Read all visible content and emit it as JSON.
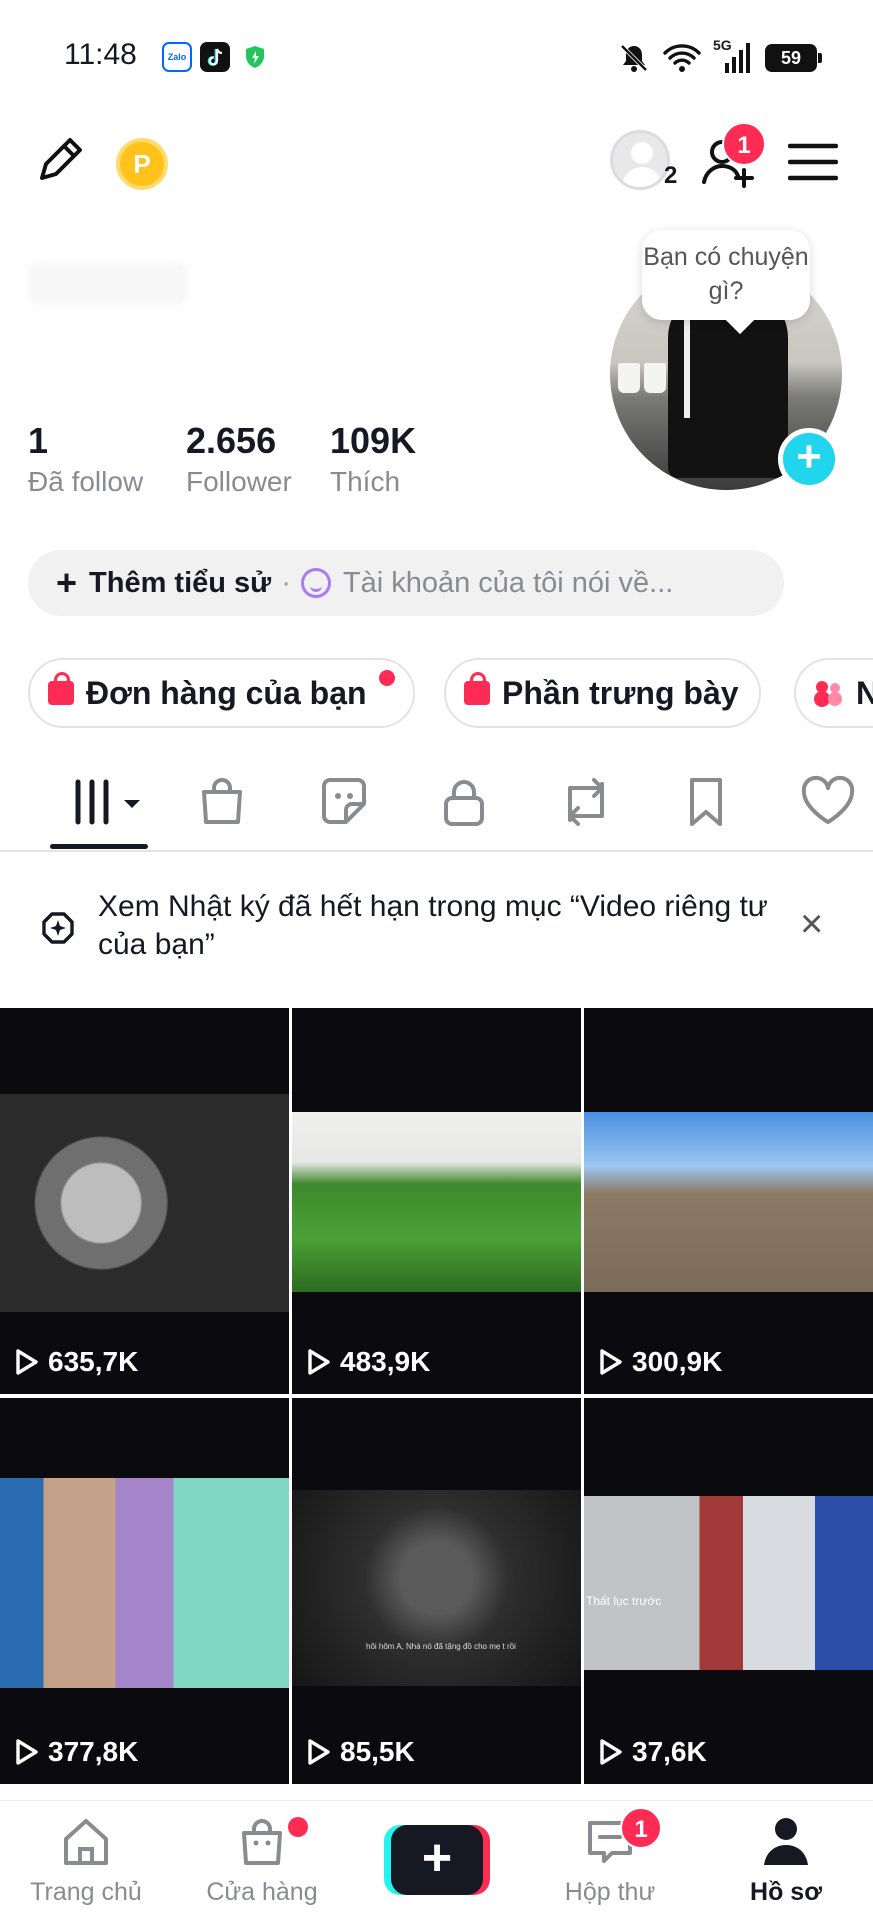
{
  "status_bar": {
    "time": "11:48",
    "zalo_label": "Zalo",
    "network": "5G",
    "battery": "59"
  },
  "header": {
    "coin_label": "P",
    "follower_requests_count": "2",
    "friend_badge": "1"
  },
  "profile": {
    "avatar_tooltip": "Bạn có chuyện gì?",
    "stats": [
      {
        "value": "1",
        "label": "Đã follow"
      },
      {
        "value": "2.656",
        "label": "Follower"
      },
      {
        "value": "109K",
        "label": "Thích"
      }
    ],
    "bio": {
      "add_label": "Thêm tiểu sử",
      "separator": "·",
      "hint": "Tài khoản của tôi nói về..."
    },
    "chips": [
      {
        "label": "Đơn hàng của bạn",
        "dot": true
      },
      {
        "label": "Phần trưng bày",
        "dot": false
      },
      {
        "label": "N",
        "dot": false
      }
    ]
  },
  "tabs": [
    {
      "icon": "grid-icon",
      "active": true
    },
    {
      "icon": "shop-bag-icon",
      "active": false
    },
    {
      "icon": "sticker-icon",
      "active": false
    },
    {
      "icon": "lock-icon",
      "active": false
    },
    {
      "icon": "repost-icon",
      "active": false
    },
    {
      "icon": "bookmark-icon",
      "active": false
    },
    {
      "icon": "heart-icon",
      "active": false
    }
  ],
  "notice": {
    "text": "Xem Nhật ký đã hết hạn trong mục “Video riêng tư của bạn”",
    "close": "×"
  },
  "videos": [
    {
      "views": "635,7K"
    },
    {
      "views": "483,9K"
    },
    {
      "views": "300,9K"
    },
    {
      "views": "377,8K"
    },
    {
      "views": "85,5K",
      "caption": "hôi hôm A, Nhà nó đã tặng đồ cho mẹ t rồi"
    },
    {
      "views": "37,6K",
      "caption": "Thất lục trước"
    }
  ],
  "bottom_nav": {
    "home": "Trang chủ",
    "shop": "Cửa hàng",
    "create": "+",
    "inbox": "Hộp thư",
    "inbox_badge": "1",
    "profile": "Hồ sơ"
  },
  "colors": {
    "accent": "#fe2c55",
    "cyan": "#20d5ec",
    "text": "#161823",
    "muted": "#8a8b91"
  }
}
